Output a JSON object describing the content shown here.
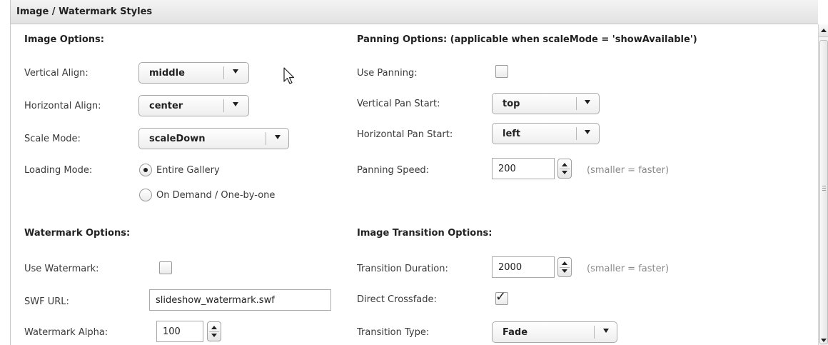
{
  "panel": {
    "title": "Image / Watermark Styles"
  },
  "image_options": {
    "heading": "Image Options:",
    "vertical_align": {
      "label": "Vertical Align:",
      "value": "middle"
    },
    "horizontal_align": {
      "label": "Horizontal Align:",
      "value": "center"
    },
    "scale_mode": {
      "label": "Scale Mode:",
      "value": "scaleDown"
    },
    "loading_mode": {
      "label": "Loading Mode:",
      "options": [
        "Entire Gallery",
        "On Demand / One-by-one"
      ],
      "selected": "Entire Gallery"
    }
  },
  "panning_options": {
    "heading": "Panning Options: (applicable when scaleMode = 'showAvailable')",
    "use_panning": {
      "label": "Use Panning:",
      "checked": false
    },
    "vertical_pan_start": {
      "label": "Vertical Pan Start:",
      "value": "top"
    },
    "horizontal_pan_start": {
      "label": "Horizontal Pan Start:",
      "value": "left"
    },
    "panning_speed": {
      "label": "Panning Speed:",
      "value": "200",
      "hint": "(smaller = faster)"
    }
  },
  "watermark_options": {
    "heading": "Watermark Options:",
    "use_watermark": {
      "label": "Use Watermark:",
      "checked": false
    },
    "swf_url": {
      "label": "SWF URL:",
      "value": "slideshow_watermark.swf"
    },
    "watermark_alpha": {
      "label": "Watermark Alpha:",
      "value": "100"
    }
  },
  "transition_options": {
    "heading": "Image Transition Options:",
    "transition_duration": {
      "label": "Transition Duration:",
      "value": "2000",
      "hint": "(smaller = faster)"
    },
    "direct_crossfade": {
      "label": "Direct Crossfade:",
      "checked": true
    },
    "transition_type": {
      "label": "Transition Type:",
      "value": "Fade"
    }
  },
  "icons": {
    "select_arrow": "chevron-down-icon",
    "spinner": "spinner-arrows-icon",
    "check": "checkmark-icon",
    "cursor": "mouse-pointer-icon"
  },
  "colors": {
    "title_bar": "#e8e8e8",
    "border": "#a9a9a9",
    "hint_text": "#8a8a8a"
  }
}
